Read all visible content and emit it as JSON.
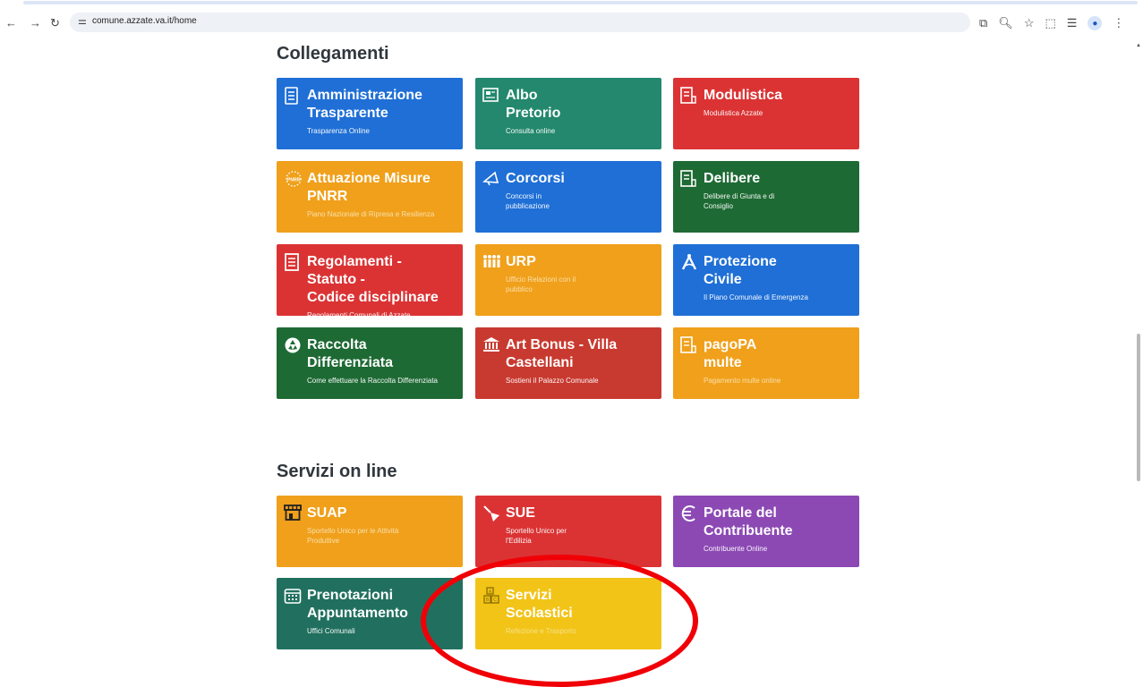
{
  "browser": {
    "url": "comune.azzate.va.it/home",
    "icons": [
      "back-arrow-icon",
      "forward-arrow-icon",
      "reload-icon",
      "site-settings-icon",
      "screenshot-icon",
      "zoom-icon",
      "bookmark-star-icon",
      "extensions-icon",
      "reading-list-icon",
      "profile-icon",
      "menu-icon"
    ]
  },
  "collegamenti": {
    "title": "Collegamenti",
    "tiles": [
      {
        "title": "Amministrazione\nTrasparente",
        "sub": "Trasparenza Online",
        "color": "#1f6fd6",
        "icon": "document-icon"
      },
      {
        "title": "Albo\nPretorio",
        "sub": "Consulta online",
        "color": "#23886d",
        "icon": "newspaper-icon"
      },
      {
        "title": "Modulistica",
        "sub": "Modulistica Azzate",
        "color": "#db3334",
        "icon": "form-icon"
      },
      {
        "title": "Attuazione Misure\nPNRR",
        "sub": "Piano Nazionale di Ripresa e Resilienza",
        "color": "#f0a01b",
        "icon": "pnrr-stars-icon"
      },
      {
        "title": "Corcorsi",
        "sub": "Concorsi in\npubblicazione",
        "color": "#1f6fd6",
        "icon": "megaphone-icon"
      },
      {
        "title": "Delibere",
        "sub": "Delibere di Giunta e di\nConsiglio",
        "color": "#1e6a34",
        "icon": "form-icon"
      },
      {
        "title": "Regolamenti - Statuto -\nCodice disciplinare",
        "sub": "Regolamenti Comunali di Azzate",
        "color": "#db3334",
        "icon": "document-lines-icon"
      },
      {
        "title": "URP",
        "sub": "Ufficio Relazioni con il\npubblico",
        "color": "#f0a01b",
        "icon": "people-icon"
      },
      {
        "title": "Protezione\nCivile",
        "sub": "Il Piano Comunale di Emergenza",
        "color": "#1f6fd6",
        "icon": "compass-icon"
      },
      {
        "title": "Raccolta\nDifferenziata",
        "sub": "Come effettuare la Raccolta Differenziata",
        "color": "#1e6a34",
        "icon": "recycle-icon"
      },
      {
        "title": "Art Bonus - Villa\nCastellani",
        "sub": "Sostieni il Palazzo Comunale",
        "color": "#c83a30",
        "icon": "bank-icon"
      },
      {
        "title": "pagoPA\nmulte",
        "sub": "Pagamento multe online",
        "color": "#f0a01b",
        "icon": "form-icon"
      }
    ]
  },
  "servizi": {
    "title": "Servizi on line",
    "tiles": [
      {
        "title": "SUAP",
        "sub": "Sportello Unico per le Attività\nProduttive",
        "color": "#f0a01b",
        "icon": "shop-icon"
      },
      {
        "title": "SUE",
        "sub": "Sportello Unico per\nl'Edilizia",
        "color": "#db3334",
        "icon": "trowel-icon"
      },
      {
        "title": "Portale del\nContribuente",
        "sub": "Contribuente Online",
        "color": "#8c49b4",
        "icon": "euro-icon"
      },
      {
        "title": "Prenotazioni\nAppuntamento",
        "sub": "Uffici Comunali",
        "color": "#21705f",
        "icon": "calendar-icon"
      },
      {
        "title": "Servizi\nScolastici",
        "sub": "Refezione e Trasporto",
        "color": "#f2c418",
        "icon": "toy-blocks-icon"
      }
    ]
  }
}
